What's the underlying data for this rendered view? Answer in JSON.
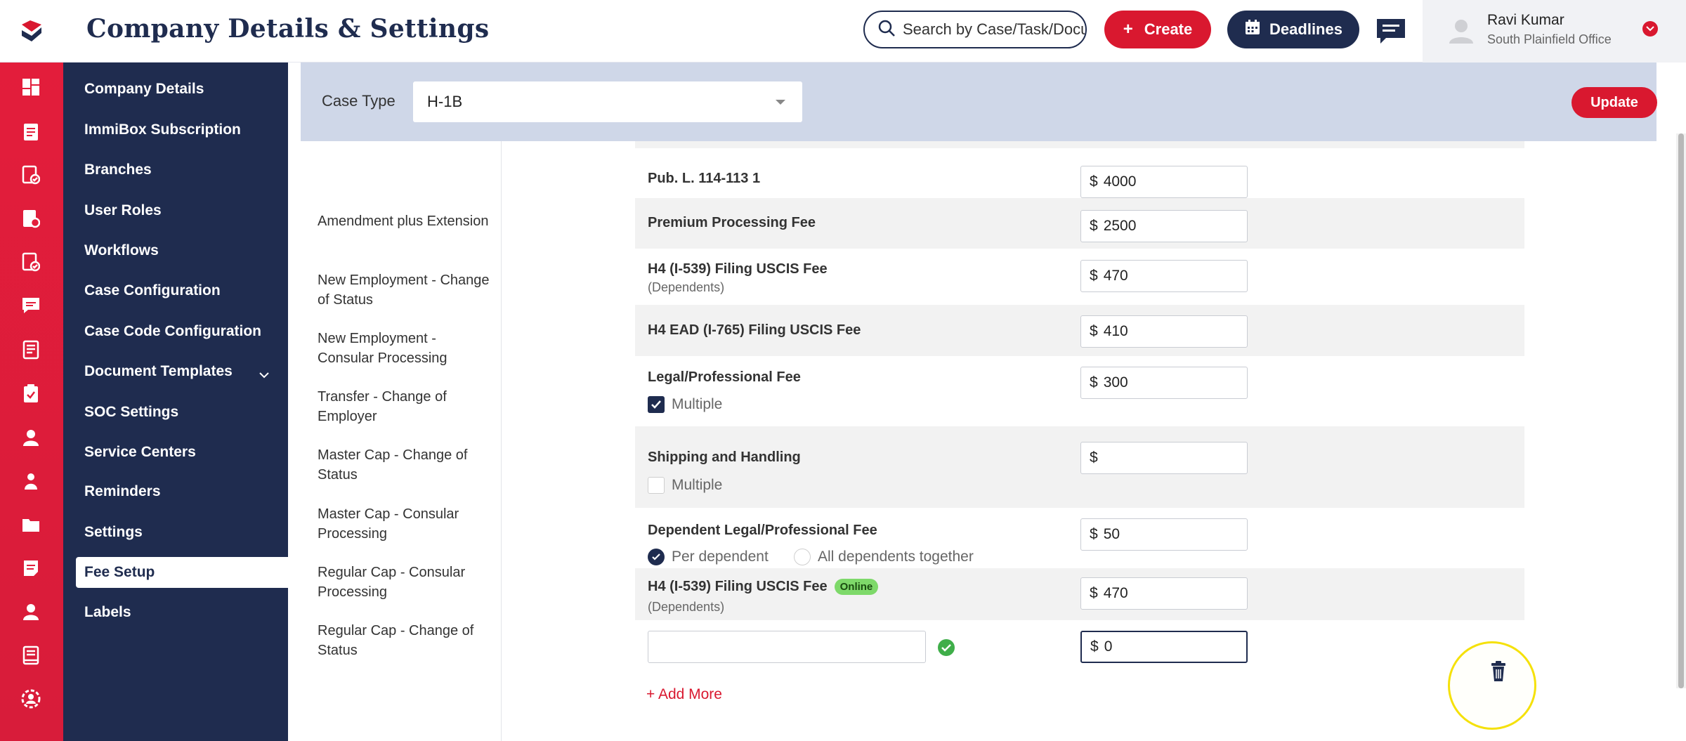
{
  "header": {
    "title": "Company Details & Settings",
    "search_placeholder": "Search by Case/Task/Docu",
    "create_label": "Create",
    "deadlines_label": "Deadlines",
    "user_name": "Ravi Kumar",
    "user_office": "South Plainfield Office"
  },
  "rail": {
    "icons": [
      "dashboard-icon",
      "cases-icon",
      "tasks-icon",
      "calendar-icon",
      "documents-icon",
      "messages-icon",
      "reports-icon",
      "clipboard-icon",
      "user-icon",
      "people-icon",
      "folder-icon",
      "notes-icon",
      "person-icon",
      "book-icon",
      "team-settings-icon"
    ]
  },
  "nav": {
    "items": [
      {
        "label": "Company Details"
      },
      {
        "label": "ImmiBox Subscription"
      },
      {
        "label": "Branches"
      },
      {
        "label": "User Roles"
      },
      {
        "label": "Workflows"
      },
      {
        "label": "Case Configuration"
      },
      {
        "label": "Case Code Configuration"
      },
      {
        "label": "Document Templates"
      },
      {
        "label": "SOC Settings"
      },
      {
        "label": "Service Centers"
      },
      {
        "label": "Reminders"
      },
      {
        "label": "Settings"
      },
      {
        "label": "Fee Setup"
      },
      {
        "label": "Labels"
      }
    ],
    "active": "Fee Setup"
  },
  "case_type": {
    "label": "Case Type",
    "value": "H-1B",
    "update_label": "Update"
  },
  "sub_types": [
    {
      "label": "Amendment plus Extension"
    },
    {
      "label": "New Employment - Change of Status"
    },
    {
      "label": "New Employment - Consular Processing"
    },
    {
      "label": "Transfer - Change of Employer"
    },
    {
      "label": "Master Cap - Change of Status"
    },
    {
      "label": "Master Cap - Consular Processing"
    },
    {
      "label": "Regular Cap - Consular Processing"
    },
    {
      "label": "Regular Cap - Change of Status"
    }
  ],
  "fees": {
    "currency": "$",
    "rows": [
      {
        "name": "Pub. L. 114-113 1",
        "amount": "4000"
      },
      {
        "name": "Premium Processing Fee",
        "amount": "2500"
      },
      {
        "name": "H4 (I-539) Filing USCIS Fee",
        "sub": "(Dependents)",
        "amount": "470"
      },
      {
        "name": "H4 EAD (I-765) Filing USCIS Fee",
        "amount": "410"
      },
      {
        "name": "Legal/Professional Fee",
        "amount": "300",
        "multiple_label": "Multiple",
        "multiple_checked": true
      },
      {
        "name": "Shipping and Handling",
        "amount": "",
        "multiple_label": "Multiple",
        "multiple_checked": false
      },
      {
        "name": "Dependent Legal/Professional Fee",
        "amount": "50",
        "per_dependent_label": "Per dependent",
        "all_dependents_label": "All dependents together"
      },
      {
        "name": "H4 (I-539) Filing USCIS Fee",
        "badge": "Online",
        "sub": "(Dependents)",
        "amount": "470"
      }
    ],
    "new_row": {
      "name": "",
      "amount": "0"
    },
    "add_more_label": "+ Add More"
  }
}
